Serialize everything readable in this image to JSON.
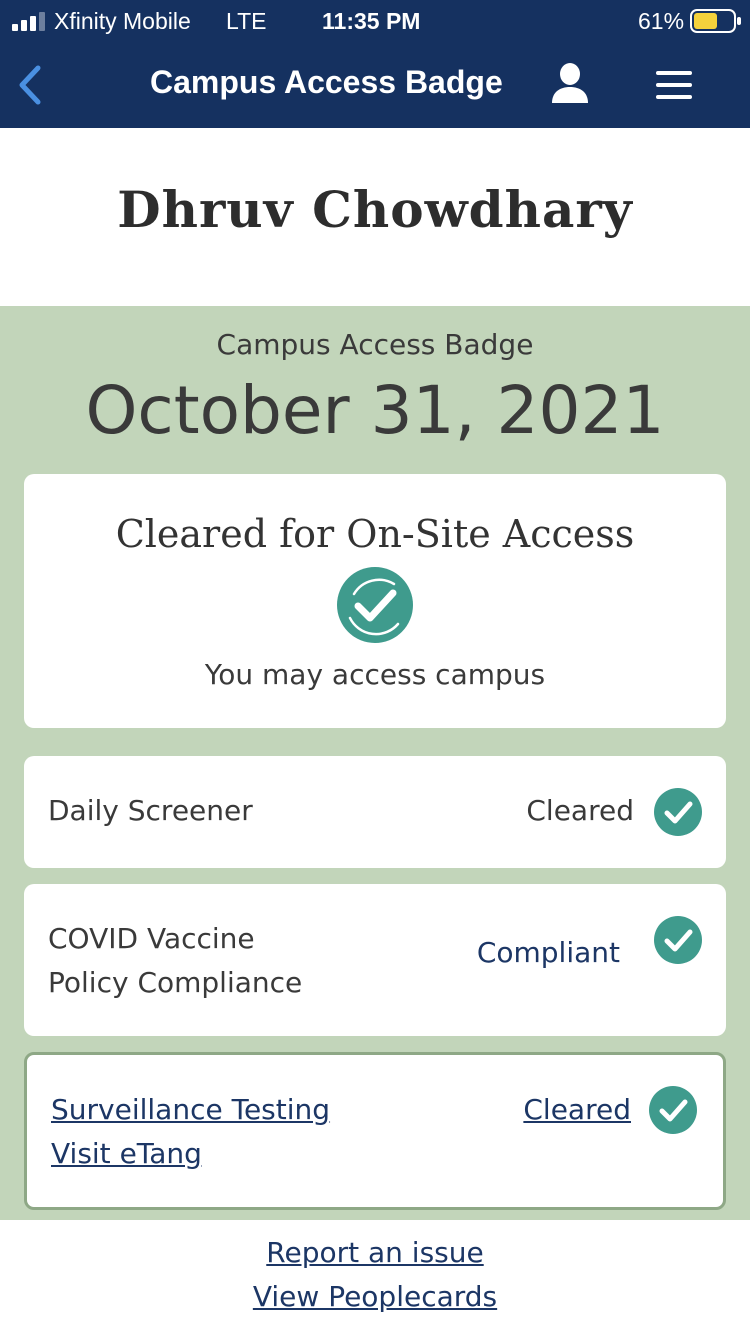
{
  "status_bar": {
    "carrier": "Xfinity Mobile",
    "network": "LTE",
    "time": "11:35 PM",
    "battery_percent": "61%",
    "battery_level": 0.61,
    "battery_color": "#f5d23c"
  },
  "nav": {
    "title": "Campus Access Badge",
    "back_icon": "chevron-left-icon",
    "user_icon": "user-icon",
    "menu_icon": "hamburger-menu-icon",
    "bar_color": "#153160",
    "back_color": "#4a90e2"
  },
  "person": {
    "name": "Dhruv Chowdhary"
  },
  "badge": {
    "label": "Campus Access Badge",
    "date": "October 31, 2021",
    "background_color": "#c2d5ba"
  },
  "clearance": {
    "heading": "Cleared for On-Site Access",
    "message": "You may access campus",
    "check_color": "#3f9b8d"
  },
  "checks": [
    {
      "label": "Daily Screener",
      "status": "Cleared"
    },
    {
      "label_line1": "COVID Vaccine",
      "label_line2": "Policy Compliance",
      "status": "Compliant"
    },
    {
      "label_line1": "Surveillance Testing",
      "label_line2": "Visit eTang",
      "status": "Cleared"
    }
  ],
  "footer": {
    "report_link": "Report an issue",
    "peoplecards_link": "View Peoplecards"
  }
}
